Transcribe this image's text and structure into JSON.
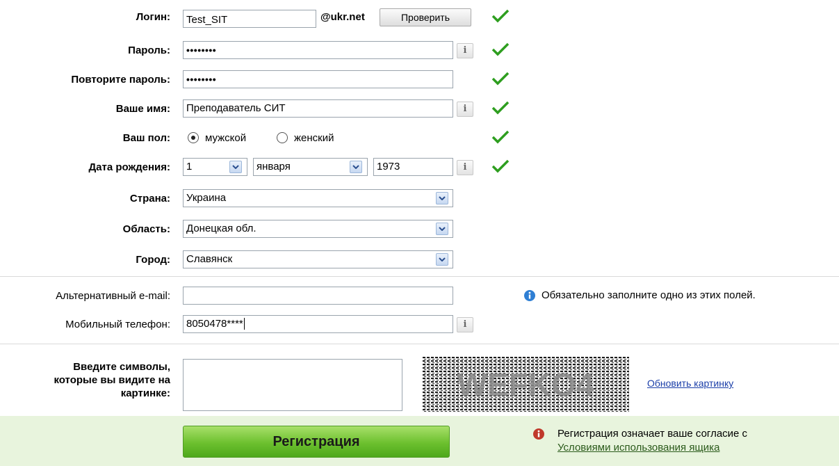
{
  "login": {
    "label": "Логин:",
    "value": "Test_SIT",
    "domain": "@ukr.net",
    "check_button": "Проверить"
  },
  "password": {
    "label": "Пароль:",
    "value": "••••••••",
    "info": "i"
  },
  "password_repeat": {
    "label": "Повторите пароль:",
    "value": "••••••••"
  },
  "name": {
    "label": "Ваше имя:",
    "value": "Преподаватель СИТ",
    "info": "i"
  },
  "gender": {
    "label": "Ваш пол:",
    "options": [
      "мужской",
      "женский"
    ],
    "selected": "мужской"
  },
  "birth": {
    "label": "Дата рождения:",
    "day": "1",
    "month": "января",
    "year": "1973",
    "info": "i"
  },
  "country": {
    "label": "Страна:",
    "value": "Украина"
  },
  "region": {
    "label": "Область:",
    "value": "Донецкая обл."
  },
  "city": {
    "label": "Город:",
    "value": "Славянск"
  },
  "alt_email": {
    "label": "Альтернативный e-mail:",
    "value": ""
  },
  "phone": {
    "label": "Мобильный телефон:",
    "value": "8050478****",
    "info": "i"
  },
  "notice": "Обязательно заполните одно из этих полей.",
  "captcha": {
    "label_lines": [
      "Введите символы,",
      "которые вы видите на",
      "картинке:"
    ],
    "value": "",
    "image_text": "WEFKO4",
    "refresh_link": "Обновить картинку"
  },
  "register_button": "Регистрация",
  "agreement": {
    "text": "Регистрация означает ваше согласие с",
    "link": "Условиями использования ящика"
  },
  "colors": {
    "check": "#2e9e1f",
    "link": "#1a3ea8",
    "band": "#e8f4dd",
    "button": "#6cc02e",
    "info_icon": "#2f7fd4",
    "warn_icon": "#c0392b"
  }
}
